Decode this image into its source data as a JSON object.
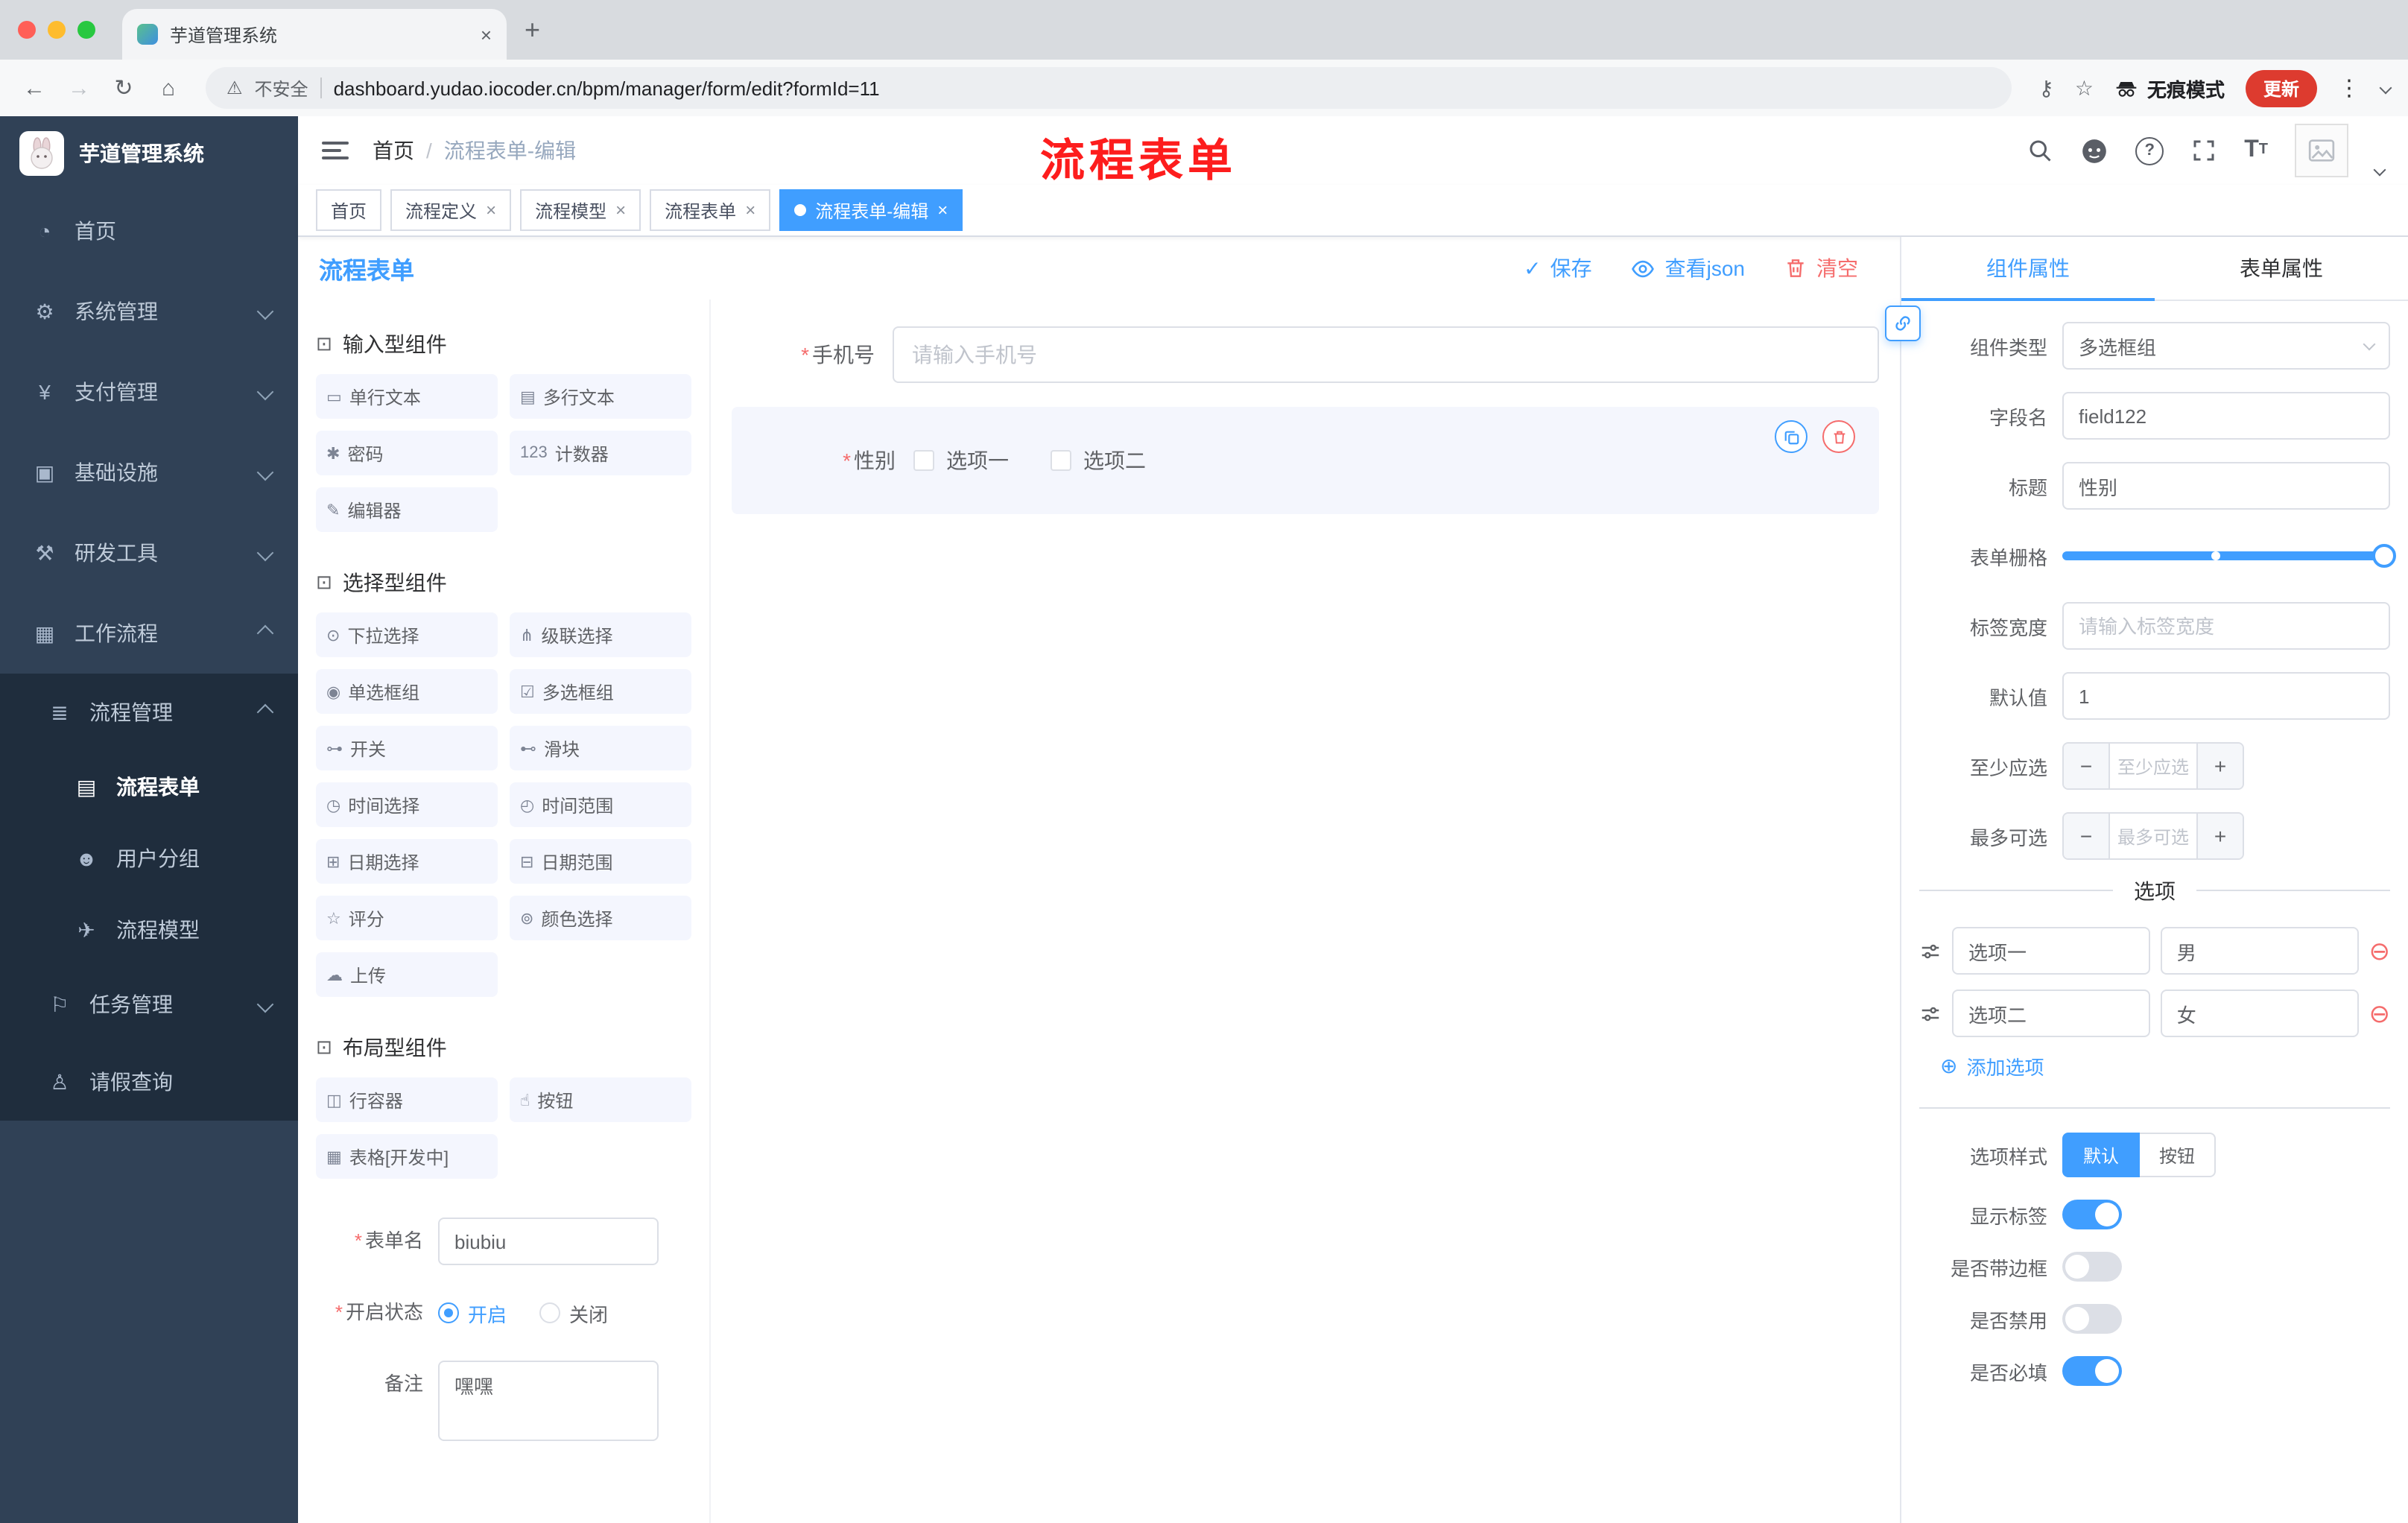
{
  "browser": {
    "tab_title": "芋道管理系统",
    "security_label": "不安全",
    "url": "dashboard.yudao.iocoder.cn/bpm/manager/form/edit?formId=11",
    "incognito_label": "无痕模式",
    "update_label": "更新"
  },
  "sidebar": {
    "logo_text": "芋道管理系统",
    "items": [
      {
        "icon": "◔",
        "label": "首页"
      },
      {
        "icon": "⚙",
        "label": "系统管理"
      },
      {
        "icon": "¥",
        "label": "支付管理"
      },
      {
        "icon": "▣",
        "label": "基础设施"
      },
      {
        "icon": "⚒",
        "label": "研发工具"
      },
      {
        "icon": "▦",
        "label": "工作流程"
      },
      {
        "icon": "≣",
        "label": "流程管理"
      },
      {
        "icon": "▤",
        "label": "流程表单"
      },
      {
        "icon": "☻",
        "label": "用户分组"
      },
      {
        "icon": "✈",
        "label": "流程模型"
      },
      {
        "icon": "⚐",
        "label": "任务管理"
      },
      {
        "icon": "♙",
        "label": "请假查询"
      }
    ]
  },
  "header": {
    "breadcrumb": {
      "root": "首页",
      "separator": "/",
      "current": "流程表单-编辑"
    },
    "annotation": "流程表单"
  },
  "tags": [
    {
      "label": "首页"
    },
    {
      "label": "流程定义"
    },
    {
      "label": "流程模型"
    },
    {
      "label": "流程表单"
    },
    {
      "label": "流程表单-编辑"
    }
  ],
  "editor": {
    "title": "流程表单",
    "save_label": "保存",
    "view_json_label": "查看json",
    "clear_label": "清空"
  },
  "components": {
    "group_icon": "⊡",
    "groups": [
      {
        "title": "输入型组件",
        "items": [
          {
            "icon": "▭",
            "label": "单行文本"
          },
          {
            "icon": "▤",
            "label": "多行文本"
          },
          {
            "icon": "✱",
            "label": "密码"
          },
          {
            "icon": "123",
            "label": "计数器"
          },
          {
            "icon": "✎",
            "label": "编辑器"
          }
        ]
      },
      {
        "title": "选择型组件",
        "items": [
          {
            "icon": "⊙",
            "label": "下拉选择"
          },
          {
            "icon": "⋔",
            "label": "级联选择"
          },
          {
            "icon": "◉",
            "label": "单选框组"
          },
          {
            "icon": "☑",
            "label": "多选框组"
          },
          {
            "icon": "⊶",
            "label": "开关"
          },
          {
            "icon": "⊷",
            "label": "滑块"
          },
          {
            "icon": "◷",
            "label": "时间选择"
          },
          {
            "icon": "◴",
            "label": "时间范围"
          },
          {
            "icon": "⊞",
            "label": "日期选择"
          },
          {
            "icon": "⊟",
            "label": "日期范围"
          },
          {
            "icon": "☆",
            "label": "评分"
          },
          {
            "icon": "⊚",
            "label": "颜色选择"
          },
          {
            "icon": "☁",
            "label": "上传"
          }
        ]
      },
      {
        "title": "布局型组件",
        "items": [
          {
            "icon": "◫",
            "label": "行容器"
          },
          {
            "icon": "☝",
            "label": "按钮"
          },
          {
            "icon": "▦",
            "label": "表格[开发中]"
          }
        ]
      }
    ]
  },
  "panel_form": {
    "name_label": "表单名",
    "name_value": "biubiu",
    "status_label": "开启状态",
    "status_on": "开启",
    "status_off": "关闭",
    "remark_label": "备注",
    "remark_value": "嘿嘿"
  },
  "canvas": {
    "phone_label": "手机号",
    "phone_placeholder": "请输入手机号",
    "gender_label": "性别",
    "gender_option1": "选项一",
    "gender_option2": "选项二"
  },
  "props": {
    "tab_component": "组件属性",
    "tab_form": "表单属性",
    "rows": {
      "type_label": "组件类型",
      "type_value": "多选框组",
      "field_label": "字段名",
      "field_value": "field122",
      "title_label": "标题",
      "title_value": "性别",
      "grid_label": "表单栅格",
      "labelwidth_label": "标签宽度",
      "labelwidth_placeholder": "请输入标签宽度",
      "default_label": "默认值",
      "default_value": "1",
      "min_label": "至少应选",
      "min_placeholder": "至少应选",
      "max_label": "最多可选",
      "max_placeholder": "最多可选"
    },
    "options_title": "选项",
    "options": [
      {
        "name": "选项一",
        "value": "男"
      },
      {
        "name": "选项二",
        "value": "女"
      }
    ],
    "add_option_label": "添加选项",
    "style_label": "选项样式",
    "style_default": "默认",
    "style_button": "按钮",
    "toggle_show_label": "显示标签",
    "toggle_border_label": "是否带边框",
    "toggle_disabled_label": "是否禁用",
    "toggle_required_label": "是否必填"
  },
  "colors": {
    "accent": "#409eff",
    "danger": "#f56c6c",
    "annotation": "#fd1d1d"
  }
}
